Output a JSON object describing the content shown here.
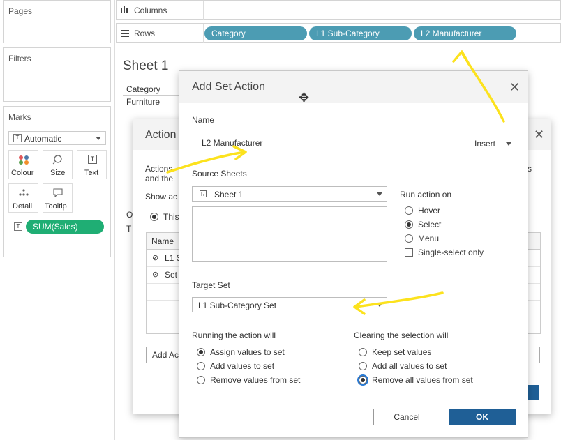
{
  "left": {
    "pages_label": "Pages",
    "filters_label": "Filters",
    "marks_label": "Marks",
    "marks_type": "Automatic",
    "mark_buttons": [
      "Colour",
      "Size",
      "Text",
      "Detail",
      "Tooltip"
    ],
    "sum_pill": "SUM(Sales)"
  },
  "shelves": {
    "columns_label": "Columns",
    "rows_label": "Rows",
    "row_pills": [
      "Category",
      "L1 Sub-Category",
      "L2 Manufacturer"
    ]
  },
  "sheet": {
    "title": "Sheet 1",
    "col_header": "Category",
    "row_value": "Furniture"
  },
  "actions_dialog": {
    "title": "Action",
    "desc1": "Actions",
    "desc2": "and the",
    "show_label": "Show ac",
    "radio_this": "This",
    "left_o": "O",
    "left_t": "T",
    "table_header": "Name",
    "rows": [
      "L1 S",
      "Set"
    ],
    "add_button": "Add Ac",
    "right_s": "s"
  },
  "set_action": {
    "title": "Add Set Action",
    "name_label": "Name",
    "name_value": "L2 Manufacturer",
    "insert_label": "Insert",
    "source_sheets_label": "Source Sheets",
    "source_sheet_value": "Sheet 1",
    "run_on_label": "Run action on",
    "run_on_options": [
      "Hover",
      "Select",
      "Menu"
    ],
    "single_select_label": "Single-select only",
    "target_set_label": "Target Set",
    "target_set_value": "L1 Sub-Category Set",
    "running_label": "Running the action will",
    "running_options": [
      "Assign values to set",
      "Add values to set",
      "Remove values from set"
    ],
    "clearing_label": "Clearing the selection will",
    "clearing_options": [
      "Keep set values",
      "Add all values to set",
      "Remove all values from set"
    ],
    "cancel_label": "Cancel",
    "ok_label": "OK"
  },
  "colors": {
    "pill_blue": "#4c9cb3",
    "pill_green": "#1fae74",
    "ok_blue": "#1f5f96",
    "annotation_yellow": "#fce21d"
  }
}
